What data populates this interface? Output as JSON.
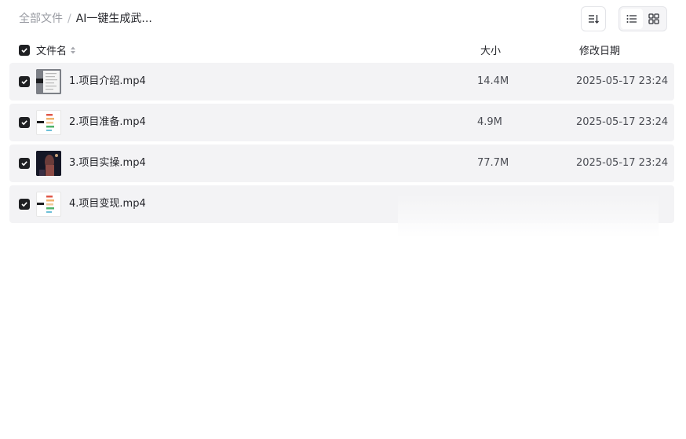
{
  "breadcrumb": {
    "root": "全部文件",
    "separator": "/",
    "current": "AI一键生成武..."
  },
  "toolbar": {
    "sort_icon": "sort-icon",
    "list_view_icon": "list-view-icon",
    "grid_view_icon": "grid-view-icon",
    "active_view": "list"
  },
  "columns": {
    "name": "文件名",
    "size": "大小",
    "date": "修改日期"
  },
  "files": [
    {
      "name": "1.项目介绍.mp4",
      "size": "14.4M",
      "date": "2025-05-17 23:24",
      "checked": true,
      "thumb": "dark-screenshot"
    },
    {
      "name": "2.项目准备.mp4",
      "size": "4.9M",
      "date": "2025-05-17 23:24",
      "checked": true,
      "thumb": "mindmap"
    },
    {
      "name": "3.项目实操.mp4",
      "size": "77.7M",
      "date": "2025-05-17 23:24",
      "checked": true,
      "thumb": "night-scene"
    },
    {
      "name": "4.项目变现.mp4",
      "size": "",
      "date": "",
      "checked": true,
      "thumb": "mindmap"
    }
  ],
  "colors": {
    "row_bg": "#f3f3f5",
    "checkbox": "#1f2023",
    "text": "#25262b",
    "muted": "#9a9ca3"
  }
}
